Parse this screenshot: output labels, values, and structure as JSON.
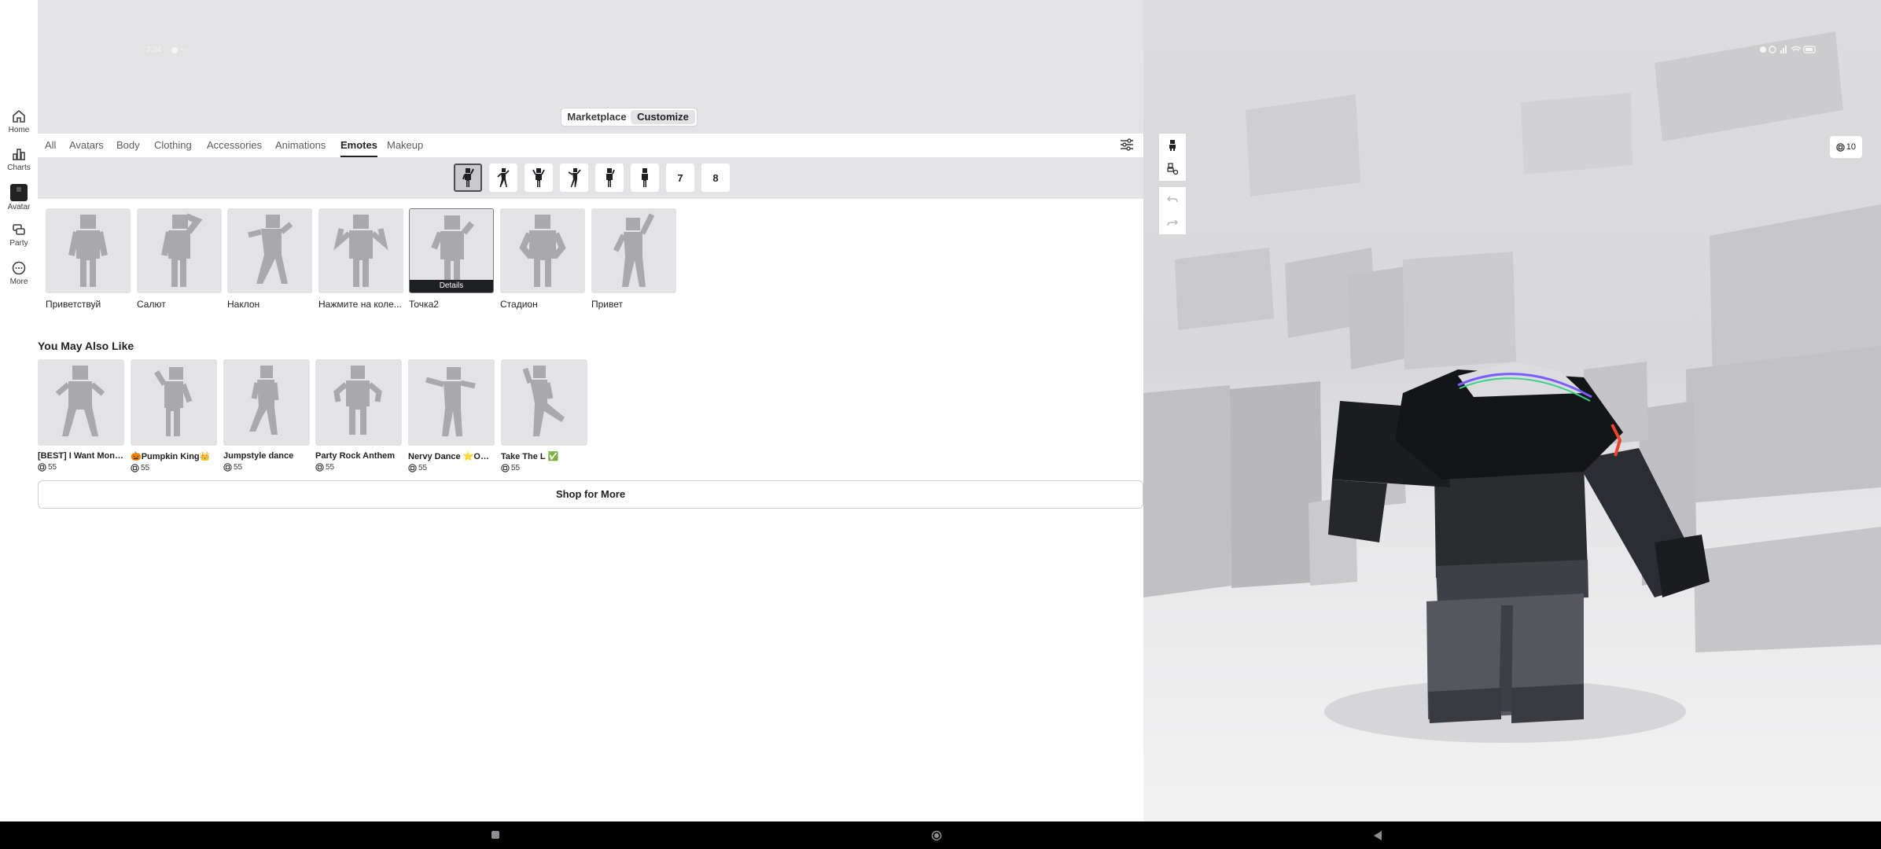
{
  "status_bar": {
    "time": "2:34",
    "extra": "···"
  },
  "nav": [
    {
      "label": "Home",
      "icon": "home-icon"
    },
    {
      "label": "Charts",
      "icon": "charts-icon"
    },
    {
      "label": "Avatar",
      "icon": "avatar-icon"
    },
    {
      "label": "Party",
      "icon": "party-icon"
    },
    {
      "label": "More",
      "icon": "more-icon"
    }
  ],
  "segment": {
    "left": "Marketplace",
    "right": "Customize",
    "selected": "Customize"
  },
  "tabs": [
    "All",
    "Avatars",
    "Body",
    "Clothing",
    "Accessories",
    "Animations",
    "Emotes",
    "Makeup"
  ],
  "active_tab": "Emotes",
  "slots": {
    "numbered": [
      "7",
      "8"
    ],
    "selected_index": 0
  },
  "emotes": [
    {
      "label": "Приветствуй"
    },
    {
      "label": "Салют"
    },
    {
      "label": "Наклон"
    },
    {
      "label": "Нажмите на коле..."
    },
    {
      "label": "Точка2",
      "overlay": "Details"
    },
    {
      "label": "Стадион"
    },
    {
      "label": "Привет"
    }
  ],
  "recommendations": {
    "title": "You May Also Like",
    "items": [
      {
        "name": "[BEST] I Want Money",
        "price": "55"
      },
      {
        "name": "🎃Pumpkin King👑",
        "price": "55"
      },
      {
        "name": "Jumpstyle dance",
        "price": "55"
      },
      {
        "name": "Party Rock Anthem",
        "price": "55"
      },
      {
        "name": "Nervy Dance ⭐ORIG...",
        "price": "55"
      },
      {
        "name": "Take The L ✅",
        "price": "55"
      }
    ]
  },
  "shop_more": "Shop for More",
  "robux_balance": "10",
  "colors": {
    "accent": "#1f2023",
    "panel": "#e3e3e5"
  }
}
